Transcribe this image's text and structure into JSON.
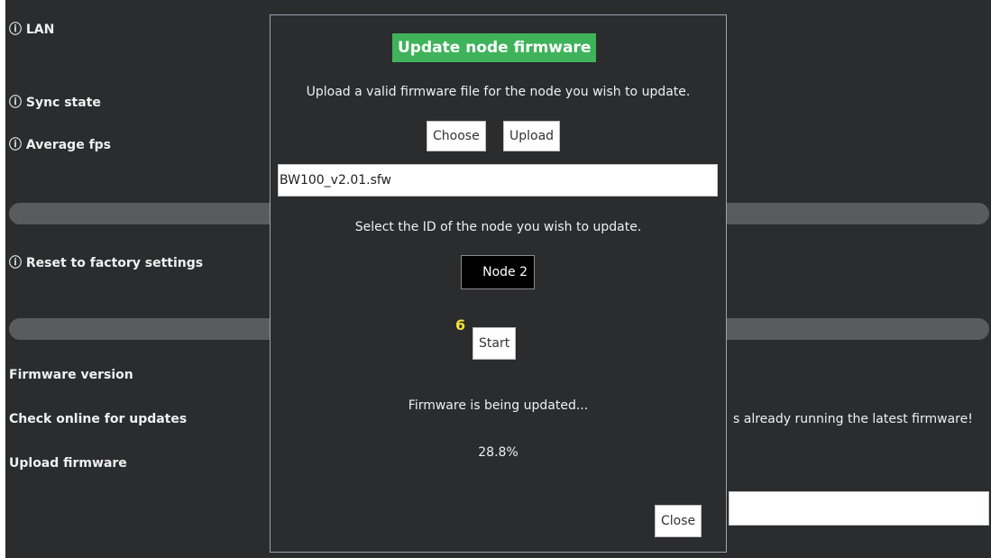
{
  "background": {
    "labels": {
      "lan": "ⓘ LAN",
      "sync_state": "ⓘ Sync state",
      "average_fps": "ⓘ Average fps",
      "reset_factory": "ⓘ Reset to factory settings",
      "firmware_version": "Firmware version",
      "check_online": "Check online for updates",
      "upload_firmware": "Upload firmware"
    },
    "update_status_text": "s already running the latest firmware!"
  },
  "modal": {
    "title": "Update node firmware",
    "upload_instruction": "Upload a valid firmware file for the node you wish to update.",
    "choose_label": "Choose",
    "upload_label": "Upload",
    "file_name": "BW100_v2.01.sfw",
    "select_instruction": "Select the ID of the node you wish to update.",
    "node_selected": "Node 2",
    "step_number": "6",
    "start_label": "Start",
    "status_text": "Firmware is being updated...",
    "progress": "28.8%",
    "close_label": "Close"
  },
  "colors": {
    "page_bg": "#2b2c2e",
    "title_bg": "#3fb35a",
    "step_badge": "#f7e03a"
  }
}
